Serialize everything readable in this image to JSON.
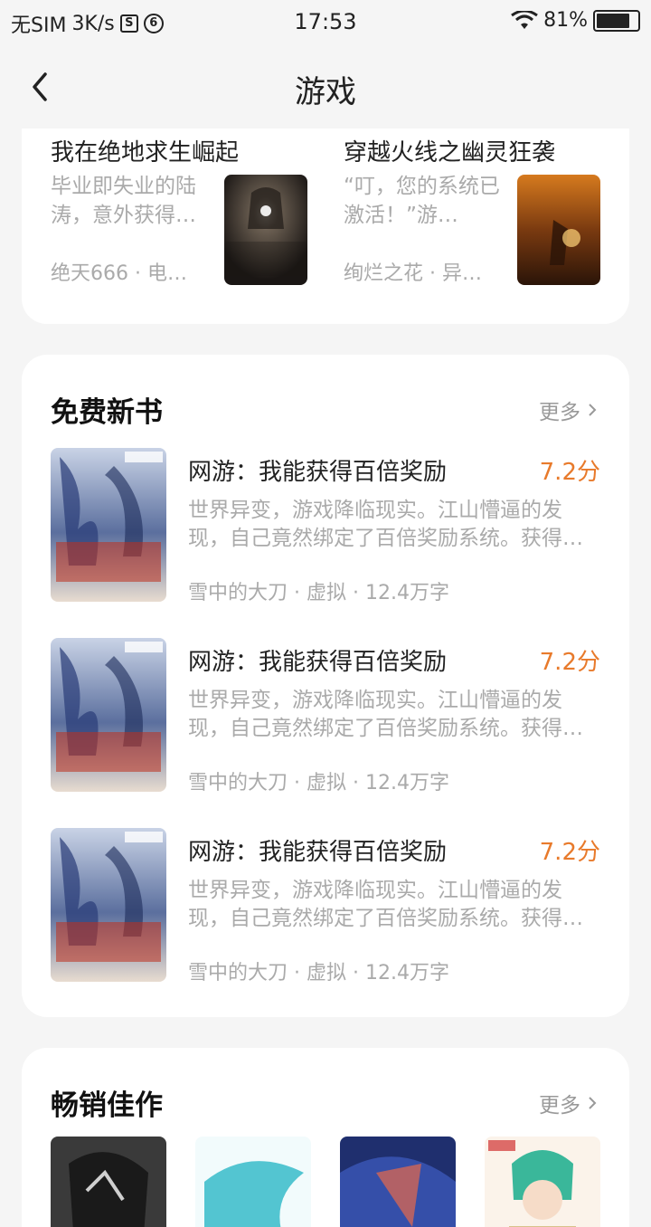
{
  "status_bar": {
    "sim": "无SIM",
    "speed": "3K/s",
    "time": "17:53",
    "battery": "81%",
    "battery_level": 0.81
  },
  "header": {
    "title": "游戏"
  },
  "top_pair": [
    {
      "title": "我在绝地求生崛起",
      "desc": "毕业即失业的陆涛，意外获得…",
      "meta": "绝天666 · 电…"
    },
    {
      "title": "穿越火线之幽灵狂袭",
      "desc": "“叮，您的系统已激活！”游…",
      "meta": "绚烂之花 · 异…"
    }
  ],
  "free_new": {
    "title": "免费新书",
    "more": "更多",
    "books": [
      {
        "title": "网游：我能获得百倍奖励",
        "score": "7.2分",
        "desc": "世界异变，游戏降临现实。江山懵逼的发现，自己竟然绑定了百倍奖励系统。获得…",
        "meta": "雪中的大刀 · 虚拟 · 12.4万字"
      },
      {
        "title": "网游：我能获得百倍奖励",
        "score": "7.2分",
        "desc": "世界异变，游戏降临现实。江山懵逼的发现，自己竟然绑定了百倍奖励系统。获得…",
        "meta": "雪中的大刀 · 虚拟 · 12.4万字"
      },
      {
        "title": "网游：我能获得百倍奖励",
        "score": "7.2分",
        "desc": "世界异变，游戏降临现实。江山懵逼的发现，自己竟然绑定了百倍奖励系统。获得…",
        "meta": "雪中的大刀 · 虚拟 · 12.4万字"
      }
    ]
  },
  "bestsellers": {
    "title": "畅销佳作",
    "more": "更多"
  },
  "colors": {
    "score": "#e87a2b",
    "muted": "#aaaaaa",
    "card": "#ffffff",
    "background": "#f5f5f5"
  }
}
